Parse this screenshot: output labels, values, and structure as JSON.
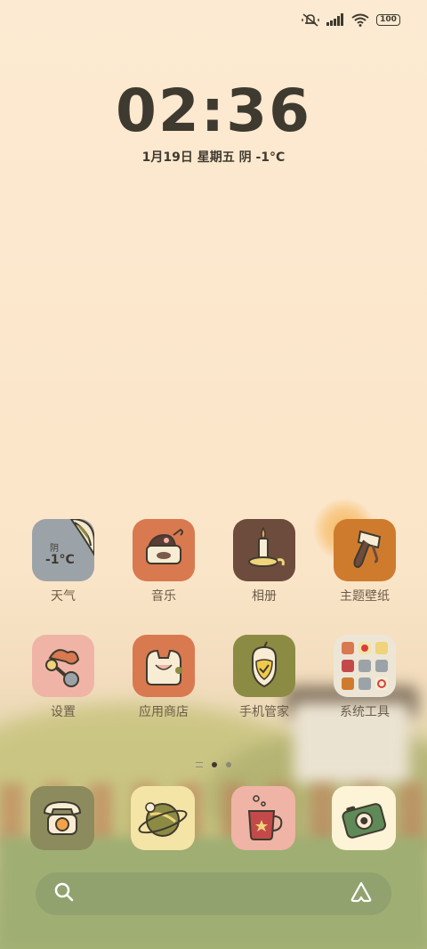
{
  "status_bar": {
    "icons": [
      "mute-vibrate-icon",
      "signal-icon",
      "wifi-icon"
    ],
    "battery": "100"
  },
  "clock": {
    "time": "02:36",
    "date": "1月19日  星期五  阴  -1°C"
  },
  "apps": [
    {
      "label": "天气",
      "icon": "weather-icon",
      "weather_cond": "阴",
      "weather_temp": "-1°C",
      "bg": "#9ca3a8"
    },
    {
      "label": "音乐",
      "icon": "music-icon",
      "bg": "#d9794f"
    },
    {
      "label": "相册",
      "icon": "candle-icon",
      "bg": "#6d4c3e"
    },
    {
      "label": "主题壁纸",
      "icon": "paint-brush-icon",
      "bg": "#cf7b2e"
    },
    {
      "label": "设置",
      "icon": "tools-icon",
      "bg": "#efb4a6"
    },
    {
      "label": "应用商店",
      "icon": "store-bag-icon",
      "bg": "#d9794f"
    },
    {
      "label": "手机管家",
      "icon": "shield-acorn-icon",
      "bg": "#8c8b43"
    },
    {
      "label": "系统工具",
      "icon": "folder-icon",
      "bg": "#ede6d6"
    }
  ],
  "dock": [
    {
      "icon": "phone-icon",
      "bg": "#8c8b5e"
    },
    {
      "icon": "browser-planet-icon",
      "bg": "#f4e4a6"
    },
    {
      "icon": "messages-mug-icon",
      "bg": "#efb4a6"
    },
    {
      "icon": "camera-icon",
      "bg": "#fdf3d6"
    }
  ],
  "search": {
    "left_icon": "search-icon",
    "right_icon": "assistant-icon"
  }
}
